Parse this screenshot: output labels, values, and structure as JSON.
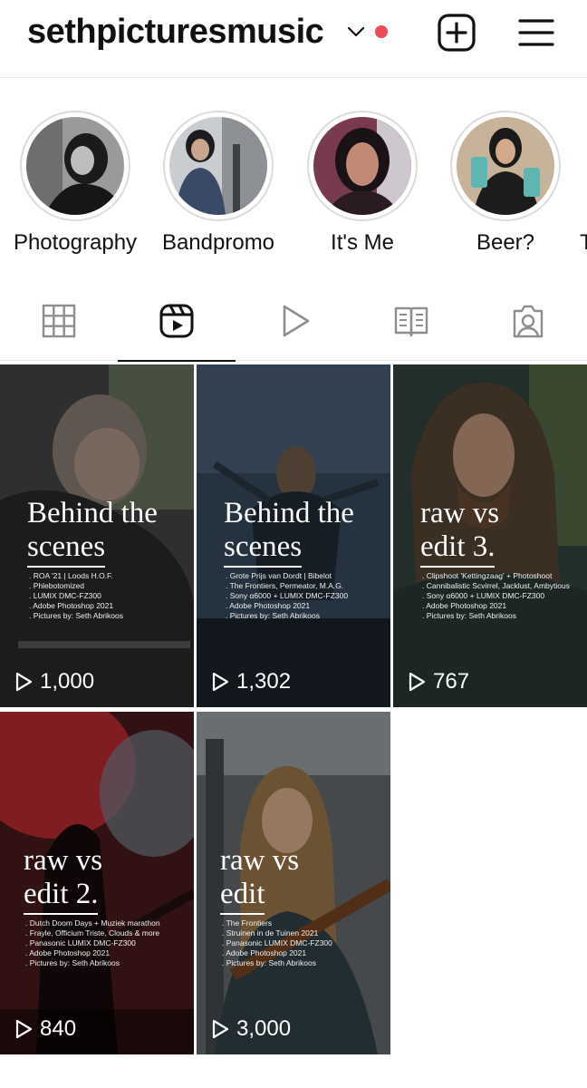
{
  "header": {
    "username": "sethpicturesmusic",
    "notification_color": "#ed4956"
  },
  "highlights": [
    {
      "label": "Photography"
    },
    {
      "label": "Bandpromo"
    },
    {
      "label": "It's Me"
    },
    {
      "label": "Beer?"
    },
    {
      "label": "T"
    }
  ],
  "tabs": [
    {
      "icon": "grid-icon",
      "active": false
    },
    {
      "icon": "reels-icon",
      "active": true
    },
    {
      "icon": "video-play-icon",
      "active": false
    },
    {
      "icon": "guides-icon",
      "active": false
    },
    {
      "icon": "tagged-icon",
      "active": false
    }
  ],
  "reels": [
    {
      "title_line1": "Behind the",
      "title_line2": "scenes",
      "info": [
        ". ROA '21 | Loods H.O.F.",
        ". Phlebotomized",
        ". LUMIX DMC-FZ300",
        ". Adobe Photoshop 2021",
        ". Pictures by: Seth Abrikoos"
      ],
      "views": "1,000"
    },
    {
      "title_line1": "Behind the",
      "title_line2": "scenes",
      "info": [
        ". Grote Prijs van Dordt | Bibelot",
        ". The Frontiers, Permeator, M.A.G.",
        ". Sony α6000 + LUMIX DMC-FZ300",
        ". Adobe Photoshop 2021",
        ". Pictures by: Seth Abrikoos"
      ],
      "views": "1,302"
    },
    {
      "title_line1": "raw vs",
      "title_line2": "edit 3.",
      "info": [
        ". Clipshoot 'Kettingzaag' + Photoshoot",
        ". Cannibalistic Scvirrel, Jacklust, Ambytious",
        ". Sony α6000 + LUMIX DMC-FZ300",
        ". Adobe Photoshop 2021",
        ". Pictures by: Seth Abrikoos"
      ],
      "views": "767"
    },
    {
      "title_line1": "raw vs",
      "title_line2": "edit 2.",
      "info": [
        ". Dutch Doom Days + Muziek marathon",
        ". Frayle, Officium Triste, Clouds & more",
        ". Panasonic LUMIX DMC-FZ300",
        ". Adobe Photoshop 2021",
        ". Pictures by: Seth Abrikoos"
      ],
      "views": "840"
    },
    {
      "title_line1": "raw vs",
      "title_line2": "edit",
      "info": [
        ". The Frontiers",
        ". Struinen in de Tuinen 2021",
        ". Panasonic LUMIX DMC-FZ300",
        ". Adobe Photoshop 2021",
        ". Pictures by: Seth Abrikoos"
      ],
      "views": "3,000"
    }
  ]
}
